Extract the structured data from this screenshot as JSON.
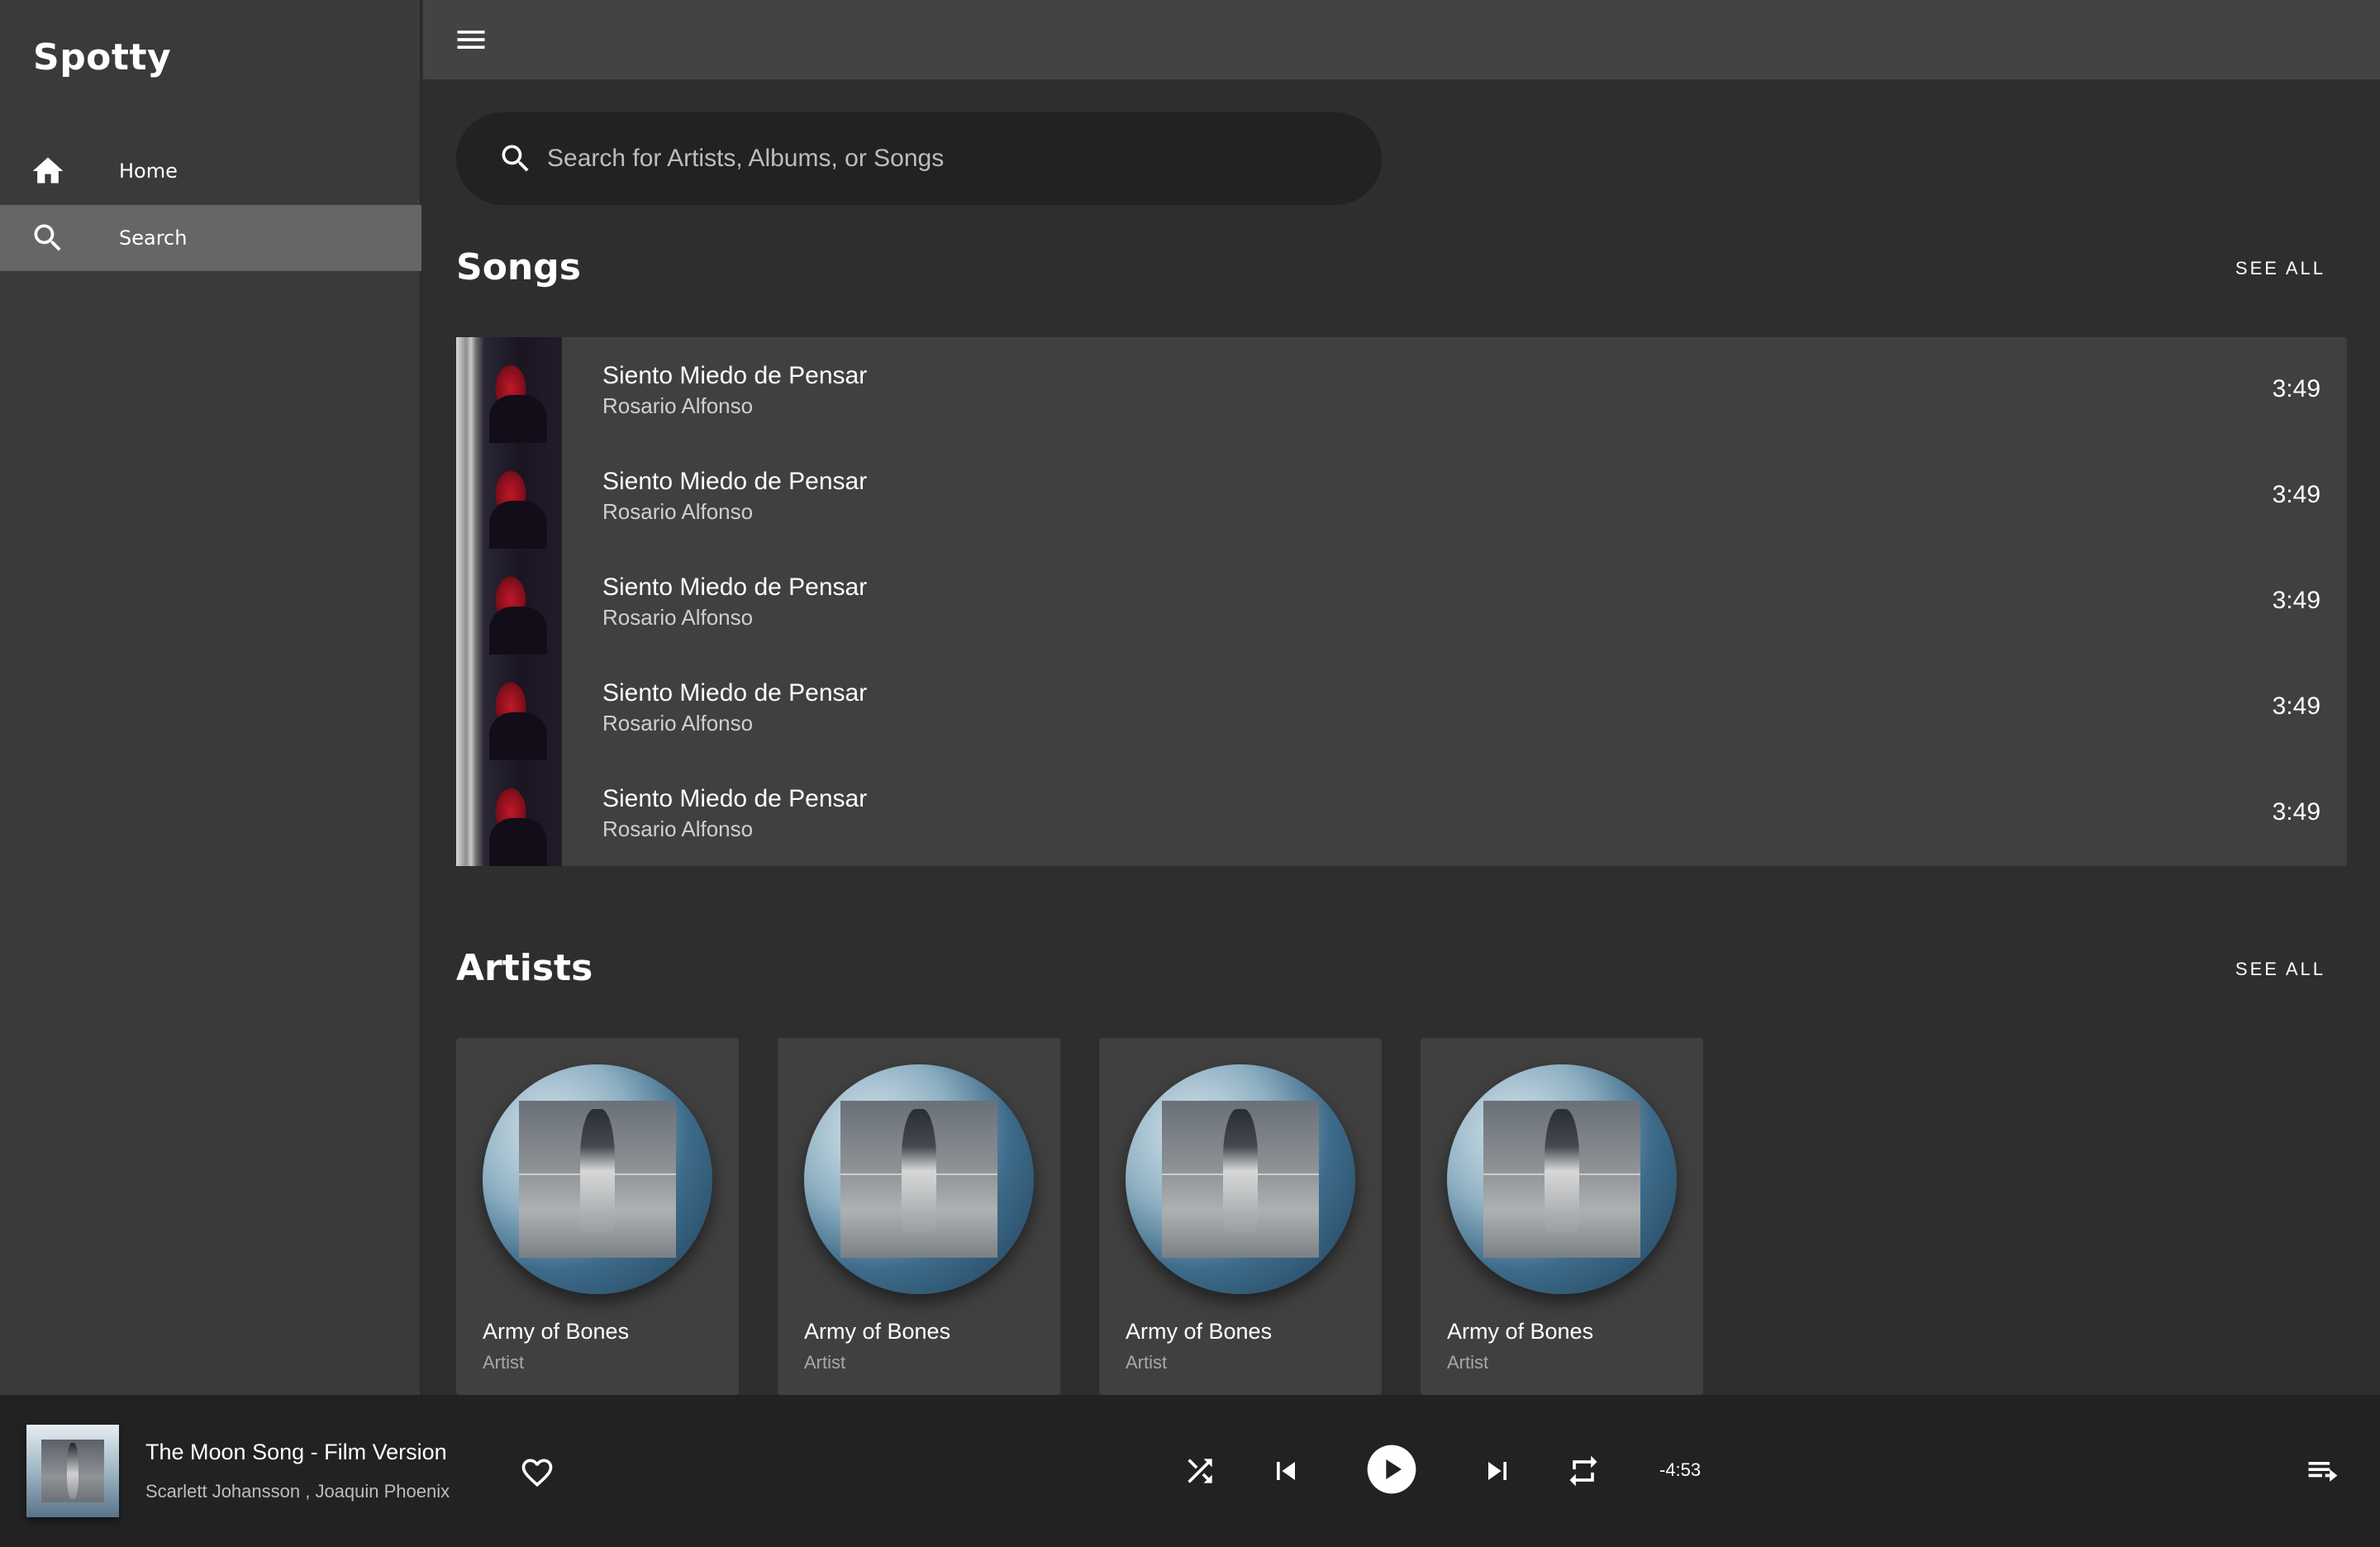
{
  "app": {
    "title": "Spotty"
  },
  "sidebar": {
    "items": [
      {
        "label": "Home",
        "icon": "home-icon",
        "selected": false
      },
      {
        "label": "Search",
        "icon": "search-icon",
        "selected": true
      }
    ]
  },
  "search": {
    "placeholder": "Search for Artists, Albums, or Songs",
    "value": ""
  },
  "songs_section": {
    "title": "Songs",
    "see_all": "SEE ALL",
    "items": [
      {
        "title": "Siento Miedo de Pensar",
        "artist": "Rosario Alfonso",
        "duration": "3:49"
      },
      {
        "title": "Siento Miedo de Pensar",
        "artist": "Rosario Alfonso",
        "duration": "3:49"
      },
      {
        "title": "Siento Miedo de Pensar",
        "artist": "Rosario Alfonso",
        "duration": "3:49"
      },
      {
        "title": "Siento Miedo de Pensar",
        "artist": "Rosario Alfonso",
        "duration": "3:49"
      },
      {
        "title": "Siento Miedo de Pensar",
        "artist": "Rosario Alfonso",
        "duration": "3:49"
      }
    ]
  },
  "artists_section": {
    "title": "Artists",
    "see_all": "SEE ALL",
    "items": [
      {
        "name": "Army of Bones",
        "subtitle": "Artist"
      },
      {
        "name": "Army of Bones",
        "subtitle": "Artist"
      },
      {
        "name": "Army of Bones",
        "subtitle": "Artist"
      },
      {
        "name": "Army of Bones",
        "subtitle": "Artist"
      }
    ]
  },
  "player": {
    "title": "The Moon Song - Film Version",
    "artists": "Scarlett Johansson , Joaquin Phoenix",
    "time_remaining": "-4:53",
    "controls": [
      "shuffle-icon",
      "previous-icon",
      "play-icon",
      "next-icon",
      "repeat-icon"
    ],
    "like_icon": "heart-outline-icon",
    "queue_icon": "queue-icon"
  },
  "colors": {
    "sidebar_bg": "#3a3a3a",
    "selected_bg": "#666666",
    "topbar_bg": "#434343",
    "main_bg": "#2e2e2e",
    "panel_bg": "#404040",
    "player_bg": "#222222",
    "search_bg": "#222222"
  }
}
